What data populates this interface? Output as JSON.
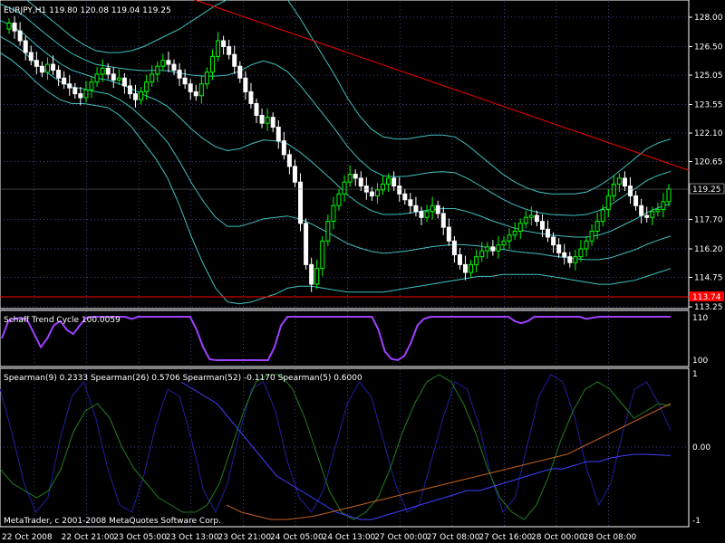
{
  "window": {
    "header": "EURJPY,H1  119.80 120.08 119.04 119.25",
    "copyright": "MetaTrader, c 2001-2008 MetaQuotes Software Corp."
  },
  "price_panel": {
    "y_ticks": [
      "128.00",
      "126.50",
      "125.05",
      "123.55",
      "122.10",
      "120.65",
      "117.70",
      "116.20",
      "114.75",
      "113.25"
    ],
    "current_price_label": "119.25",
    "support_label": "113.74",
    "colors": {
      "candle_bull": "#00ff00",
      "candle_bear": "#ffffff",
      "bands": "#40c0c0",
      "trendline": "#ff0000",
      "support_line": "#ff0000",
      "grid": "#8080ff"
    }
  },
  "stc_panel": {
    "label": "Schaff Trend Cycle 100.0059",
    "y_ticks": [
      "110",
      "100"
    ],
    "line_color": "#a040ff"
  },
  "spearman_panel": {
    "label": "Spearman(9) 0.2333  Spearman(26) 0.5706  Spearman(52) -0.1170  Spearman(5) 0.6000",
    "y_ticks": [
      "1",
      "0.00",
      "-1"
    ],
    "series_colors": [
      "#2020a0",
      "#208020",
      "#4040ff",
      "#c06020"
    ]
  },
  "time_axis": {
    "labels": [
      "22 Oct 2008",
      "22 Oct 21:00",
      "23 Oct 05:00",
      "23 Oct 13:00",
      "23 Oct 21:00",
      "24 Oct 05:00",
      "24 Oct 13:00",
      "27 Oct 00:00",
      "27 Oct 08:00",
      "27 Oct 16:00",
      "28 Oct 00:00",
      "28 Oct 08:00"
    ]
  },
  "chart_data": {
    "type": "candlestick",
    "symbol": "EURJPY",
    "timeframe": "H1",
    "ylim": [
      113.25,
      128.0
    ],
    "close_series": [
      127.7,
      127.3,
      126.8,
      126.2,
      125.8,
      125.5,
      125.2,
      125.6,
      125.3,
      124.9,
      124.6,
      124.4,
      124.1,
      123.9,
      124.3,
      124.7,
      125.1,
      125.4,
      125.1,
      124.8,
      124.9,
      124.5,
      124.1,
      123.8,
      124.2,
      124.7,
      125.1,
      125.5,
      125.8,
      125.6,
      125.3,
      124.9,
      124.6,
      124.2,
      124.0,
      124.6,
      125.2,
      126.0,
      126.8,
      126.5,
      126.1,
      125.5,
      124.9,
      124.2,
      123.6,
      123.0,
      122.6,
      122.9,
      122.4,
      121.7,
      121.0,
      120.4,
      119.6,
      117.5,
      115.4,
      114.4,
      115.2,
      116.6,
      117.6,
      118.4,
      119.0,
      119.6,
      120.0,
      119.8,
      119.4,
      119.1,
      118.9,
      119.2,
      119.5,
      119.8,
      119.4,
      119.0,
      118.7,
      118.4,
      118.1,
      117.8,
      118.1,
      118.4,
      118.0,
      117.3,
      116.6,
      115.9,
      115.4,
      115.0,
      115.4,
      115.8,
      116.1,
      116.3,
      116.1,
      116.4,
      116.6,
      116.9,
      117.1,
      117.5,
      117.8,
      117.9,
      117.6,
      117.2,
      116.8,
      116.4,
      116.0,
      115.8,
      115.5,
      115.8,
      116.2,
      116.6,
      117.1,
      117.6,
      118.2,
      118.9,
      119.5,
      119.8,
      119.4,
      118.9,
      118.4,
      117.9,
      117.8,
      118.1,
      118.2,
      118.6,
      119.25
    ],
    "upper_band_outer": [
      129.5,
      129.3,
      129.0,
      128.5,
      128.0,
      127.5,
      127.0,
      126.6,
      126.3,
      126.2,
      126.2,
      126.3,
      126.5,
      126.8,
      127.1,
      127.4,
      127.8,
      128.2,
      128.6,
      128.9,
      129.2,
      129.6,
      129.8,
      129.5,
      128.9,
      128.0,
      127.0,
      126.0,
      125.0,
      123.9,
      123.0,
      122.3,
      121.9,
      121.8,
      121.8,
      121.9,
      122.0,
      122.0,
      121.9,
      121.5,
      121.0,
      120.5,
      120.0,
      119.6,
      119.3,
      119.1,
      119.0,
      119.0,
      119.0,
      119.1,
      119.4,
      119.8,
      120.3,
      120.8,
      121.3,
      121.6,
      121.8
    ],
    "lower_band_outer": [
      126.2,
      125.8,
      125.3,
      124.7,
      124.2,
      123.8,
      123.6,
      123.6,
      123.5,
      123.4,
      123.0,
      122.4,
      121.6,
      120.8,
      119.8,
      118.4,
      116.8,
      115.4,
      114.2,
      113.5,
      113.4,
      113.5,
      113.7,
      113.9,
      114.2,
      114.3,
      114.3,
      114.2,
      114.1,
      114.0,
      114.0,
      114.0,
      114.0,
      114.1,
      114.2,
      114.3,
      114.4,
      114.5,
      114.6,
      114.7,
      114.8,
      114.8,
      114.9,
      114.9,
      114.9,
      114.9,
      114.8,
      114.7,
      114.6,
      114.5,
      114.4,
      114.4,
      114.5,
      114.6,
      114.8,
      115.0,
      115.2
    ],
    "trendline": {
      "from_price": 128.0,
      "to_price": 120.2
    },
    "support_level": 113.74,
    "stc": {
      "ylim": [
        100,
        110
      ],
      "value": 100.0059,
      "values": [
        105,
        109,
        109.5,
        109.8,
        109,
        106,
        103,
        105,
        108,
        109,
        107,
        106,
        108,
        109.8,
        110,
        110,
        110,
        110,
        110,
        110,
        109.5,
        110,
        110,
        110,
        110,
        110,
        110,
        110,
        110,
        110,
        107,
        103,
        100.2,
        100,
        100,
        100,
        100,
        100,
        100,
        100,
        100,
        100,
        103,
        108,
        110,
        110,
        110,
        110,
        110,
        110,
        110,
        110,
        110,
        110,
        110,
        110,
        110,
        110,
        107,
        102,
        100.3,
        100,
        101,
        104,
        108,
        109.5,
        110,
        110,
        110,
        110,
        110,
        110,
        110,
        110,
        110,
        110,
        110,
        110,
        110,
        109,
        108.5,
        109,
        110,
        110,
        110,
        110,
        110,
        110,
        110,
        110,
        109.5,
        109.8,
        110,
        110,
        110,
        110,
        110,
        110,
        110,
        110,
        110,
        110,
        110,
        110
      ]
    },
    "spearman": {
      "ylim": [
        -1,
        1
      ],
      "series": [
        {
          "name": "Spearman(9)",
          "last": 0.2333,
          "values": [
            0.8,
            0.2,
            -0.5,
            -0.9,
            -0.7,
            0.1,
            0.7,
            0.9,
            0.4,
            -0.3,
            -0.8,
            -0.9,
            -0.4,
            0.3,
            0.8,
            0.7,
            0.1,
            -0.6,
            -0.9,
            -0.5,
            0.2,
            0.8,
            0.9,
            0.5,
            -0.2,
            -0.7,
            -0.9,
            -0.6,
            0.0,
            0.6,
            0.9,
            0.7,
            0.1,
            -0.5,
            -0.9,
            -0.8,
            -0.2,
            0.4,
            0.9,
            0.8,
            0.3,
            -0.4,
            -0.9,
            -0.7,
            0.0,
            0.7,
            1.0,
            0.9,
            0.4,
            -0.3,
            -0.8,
            -0.5,
            0.2,
            0.8,
            0.9,
            0.6,
            0.2333
          ]
        },
        {
          "name": "Spearman(26)",
          "last": 0.5706,
          "values": [
            -0.3,
            -0.5,
            -0.6,
            -0.7,
            -0.6,
            -0.3,
            0.2,
            0.5,
            0.6,
            0.4,
            0.0,
            -0.3,
            -0.5,
            -0.7,
            -0.8,
            -0.9,
            -0.9,
            -0.8,
            -0.5,
            0.0,
            0.5,
            0.9,
            1.0,
            1.0,
            0.8,
            0.4,
            -0.1,
            -0.6,
            -0.9,
            -1.0,
            -0.9,
            -0.7,
            -0.3,
            0.2,
            0.6,
            0.9,
            1.0,
            0.9,
            0.6,
            0.2,
            -0.3,
            -0.7,
            -0.9,
            -1.0,
            -0.8,
            -0.4,
            0.1,
            0.5,
            0.8,
            0.9,
            0.8,
            0.6,
            0.4,
            0.5,
            0.6,
            0.5706
          ]
        },
        {
          "name": "Spearman(52)",
          "last": -0.117,
          "values": [
            0.9,
            0.8,
            0.7,
            0.6,
            0.4,
            0.2,
            0.0,
            -0.2,
            -0.4,
            -0.5,
            -0.6,
            -0.7,
            -0.8,
            -0.9,
            -0.95,
            -1.0,
            -1.0,
            -0.95,
            -0.9,
            -0.85,
            -0.8,
            -0.75,
            -0.7,
            -0.65,
            -0.6,
            -0.6,
            -0.55,
            -0.5,
            -0.45,
            -0.4,
            -0.35,
            -0.3,
            -0.3,
            -0.25,
            -0.2,
            -0.2,
            -0.15,
            -0.12,
            -0.1,
            -0.1,
            -0.11,
            -0.117
          ]
        },
        {
          "name": "Spearman(5)",
          "last": 0.6,
          "values": [
            -0.8,
            -0.9,
            -0.95,
            -1.0,
            -1.0,
            -0.98,
            -0.95,
            -0.9,
            -0.85,
            -0.8,
            -0.75,
            -0.7,
            -0.65,
            -0.6,
            -0.55,
            -0.5,
            -0.45,
            -0.4,
            -0.35,
            -0.3,
            -0.25,
            -0.2,
            -0.15,
            -0.1,
            0.0,
            0.1,
            0.2,
            0.3,
            0.4,
            0.5,
            0.6
          ]
        }
      ]
    }
  }
}
